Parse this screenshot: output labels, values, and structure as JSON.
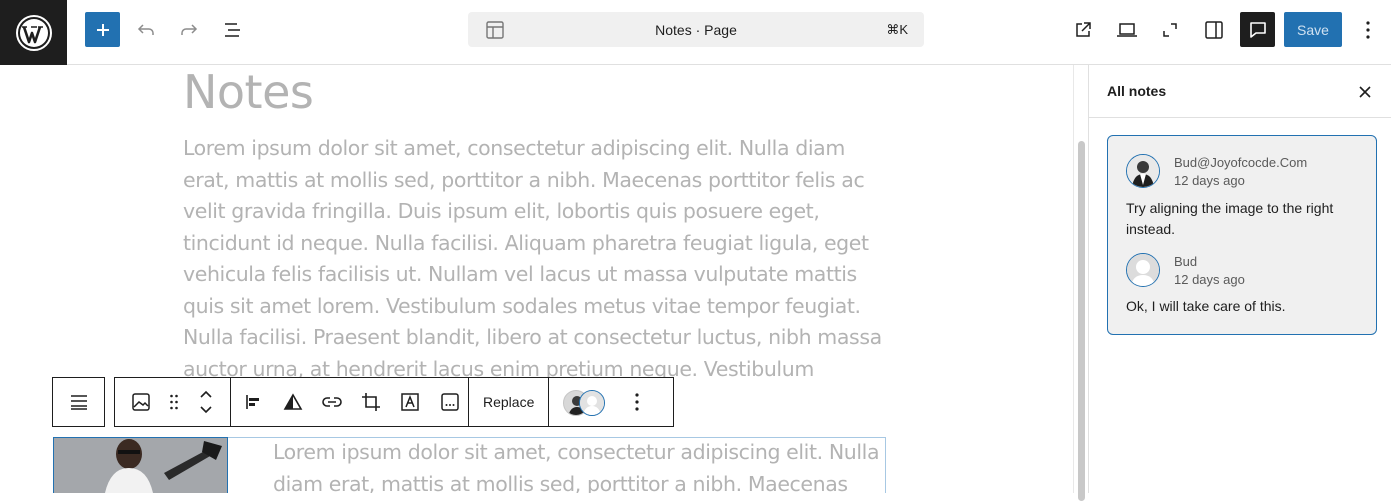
{
  "header": {
    "document_title": "Notes · Page",
    "shortcut": "⌘K",
    "save_label": "Save"
  },
  "editor": {
    "page_title": "Notes",
    "paragraph1": "Lorem ipsum dolor sit amet, consectetur adipiscing elit. Nulla diam erat, mattis at mollis sed, porttitor a nibh. Maecenas porttitor felis ac velit gravida fringilla. Duis ipsum elit, lobortis quis posuere eget, tincidunt id neque. Nulla facilisi. Aliquam pharetra feugiat ligula, eget vehicula felis facilisis ut. Nullam vel lacus ut massa vulputate mattis quis sit amet lorem. Vestibulum sodales metus vitae tempor feugiat. Nulla facilisi. Praesent blandit, libero at consectetur luctus, nibh massa auctor urna, at hendrerit lacus enim pretium neque. Vestibulum",
    "paragraph2": "Lorem ipsum dolor sit amet, consectetur adipiscing elit. Nulla diam erat, mattis at mollis sed, porttitor a nibh. Maecenas"
  },
  "block_toolbar": {
    "replace_label": "Replace"
  },
  "sidebar": {
    "title": "All notes",
    "notes": [
      {
        "author": "Bud@Joyofcocde.Com",
        "time": "12 days ago",
        "text": "Try aligning the image to the right instead."
      },
      {
        "author": "Bud",
        "time": "12 days ago",
        "text": "Ok, I will take care of this."
      }
    ]
  },
  "colors": {
    "accent": "#2271b1",
    "dark": "#1e1e1e",
    "muted_text": "#b3b3b3"
  }
}
